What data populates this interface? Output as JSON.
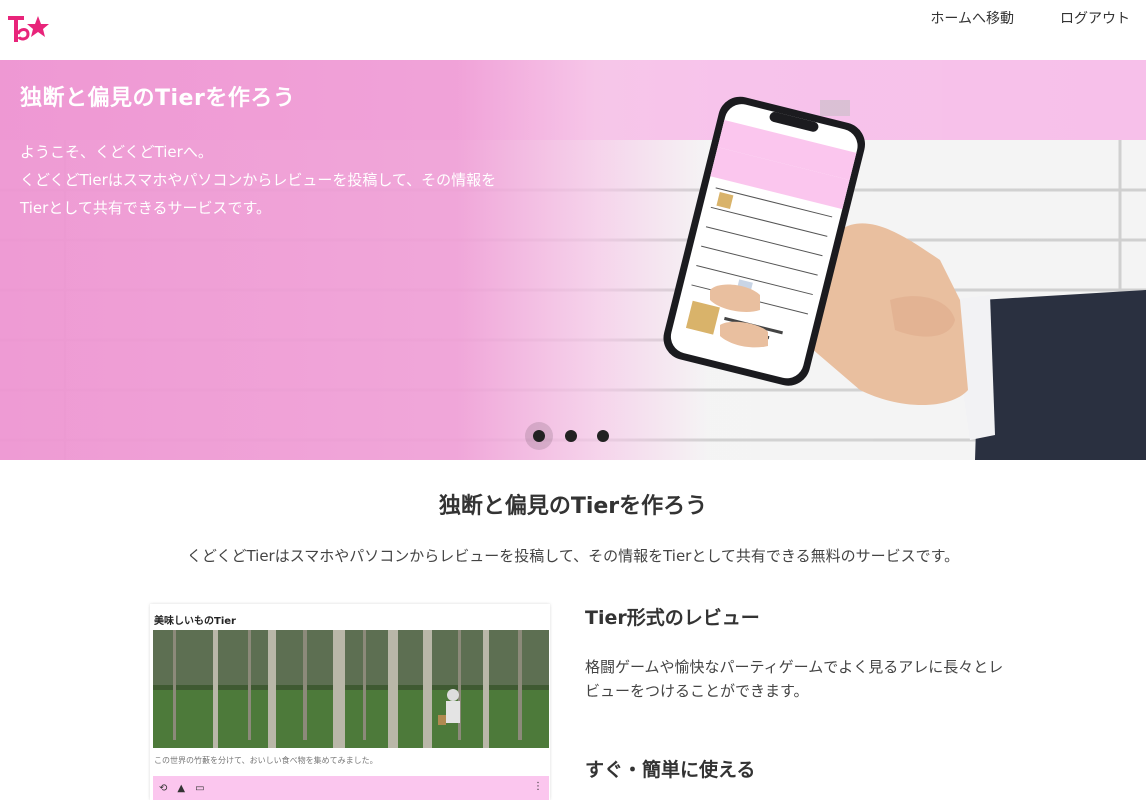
{
  "header": {
    "logo_text": "T★",
    "nav": {
      "home_label": "ホームへ移動",
      "logout_label": "ログアウト"
    }
  },
  "hero": {
    "title": "独断と偏見のTierを作ろう",
    "lines": [
      "ようこそ、くどくどTierへ。",
      "くどくどTierはスマホやパソコンからレビューを投稿して、その情報を",
      "Tierとして共有できるサービスです。"
    ],
    "slides": 3,
    "active_slide": 1
  },
  "intro": {
    "title": "独断と偏見のTierを作ろう",
    "description": "くどくどTierはスマホやパソコンからレビューを投稿して、その情報をTierとして共有できる無料のサービスです。"
  },
  "preview": {
    "title": "美味しいものTier",
    "caption": "この世界の竹藪を分けて、おいしい食べ物を集めてみました。"
  },
  "features": [
    {
      "title": "Tier形式のレビュー",
      "text": "格闘ゲームや愉快なパーティゲームでよく見るアレに長々とレビューをつけることができます。"
    },
    {
      "title": "すぐ・簡単に使える",
      "text": ""
    }
  ],
  "colors": {
    "brand_pink": "#e8247a",
    "hero_pink": "#f0a0d7",
    "toolbar_pink": "#fbc6ee"
  }
}
